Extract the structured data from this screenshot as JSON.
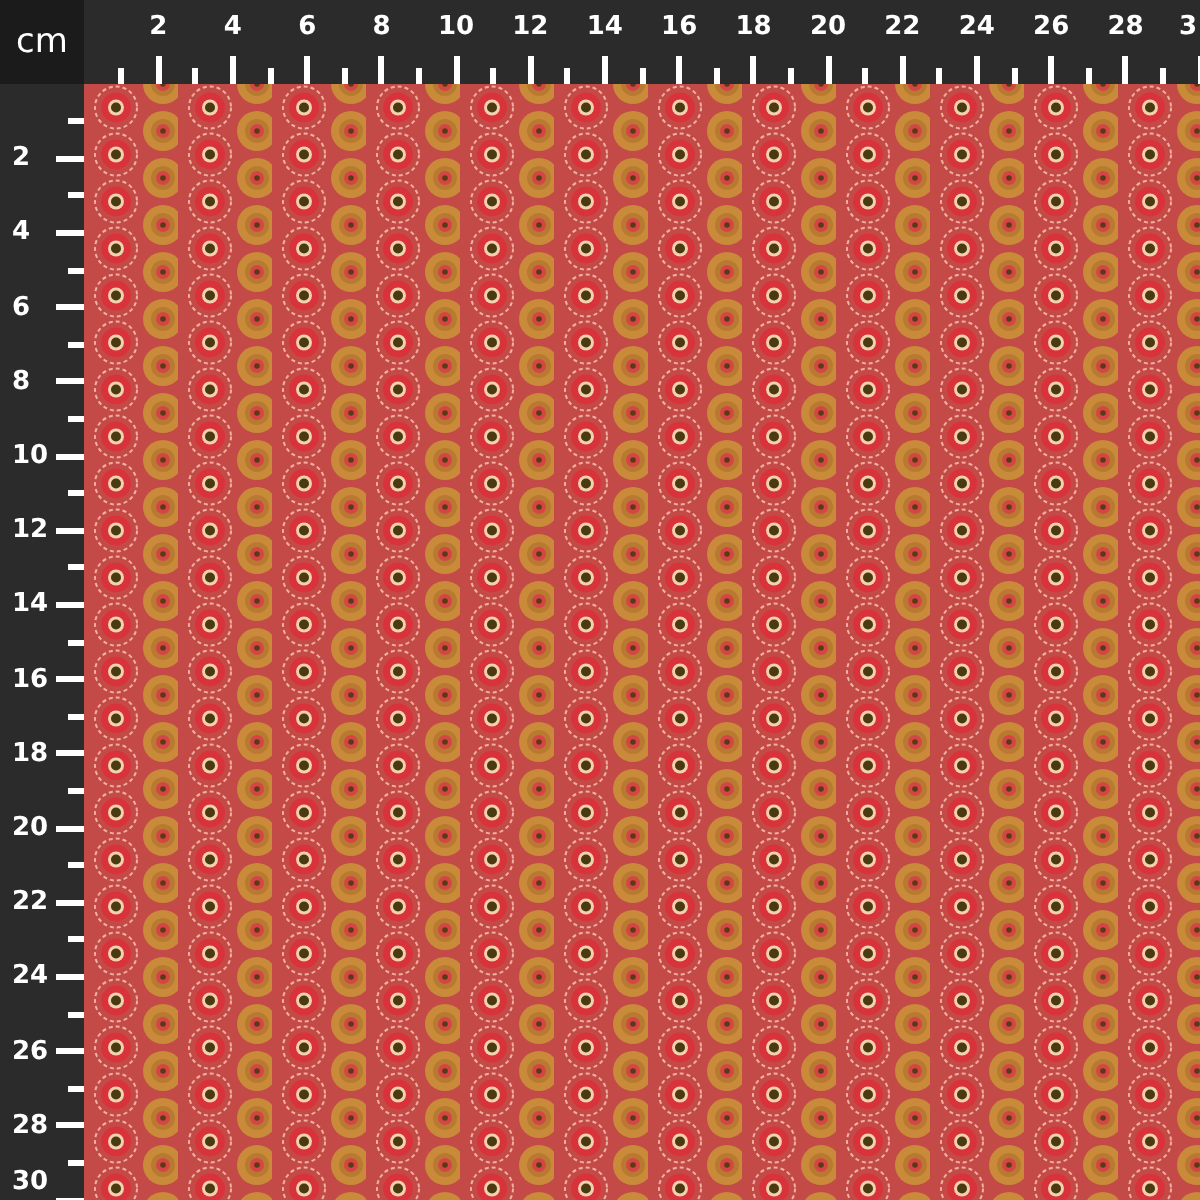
{
  "corner_label": "cm",
  "top_ruler": {
    "labels": [
      "2",
      "4",
      "6",
      "8",
      "10",
      "12",
      "14",
      "16",
      "18",
      "20",
      "22",
      "24",
      "26",
      "28",
      "3"
    ]
  },
  "left_ruler": {
    "labels": [
      "2",
      "4",
      "6",
      "8",
      "10",
      "12",
      "14",
      "16",
      "18",
      "20",
      "22",
      "24",
      "26",
      "28",
      "30"
    ]
  }
}
